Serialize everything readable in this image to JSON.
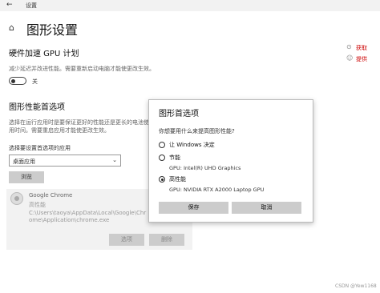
{
  "window": {
    "back_glyph": "←",
    "title": "设置"
  },
  "page": {
    "home_icon": "home-icon",
    "title": "图形设置"
  },
  "hw_accel": {
    "heading": "硬件加速 GPU 计划",
    "description": "减少延迟并改进性能。需要重新启动电脑才能使更改生效。",
    "toggle_state": "关"
  },
  "perf_pref": {
    "heading": "图形性能首选项",
    "description": "选择在运行应用时是要保证更好的性能还是更长的电池使用时间。需要重启应用才能使更改生效。",
    "select_label": "选择要设置首选项的应用",
    "app_type": "桌面应用",
    "browse_label": "浏览"
  },
  "app_entry": {
    "name": "Google Chrome",
    "preference": "高性能",
    "path": "C:\\Users\\taoya\\AppData\\Local\\Google\\Chrome\\Application\\chrome.exe",
    "options_label": "选项",
    "remove_label": "删除"
  },
  "right_links": {
    "link1": "获取",
    "link2": "提供"
  },
  "dialog": {
    "title": "图形首选项",
    "question": "你想要用什么来提高图形性能?",
    "options": [
      {
        "label": "让 Windows 决定",
        "sub": "",
        "selected": false
      },
      {
        "label": "节能",
        "sub": "GPU: Intel(R) UHD Graphics",
        "selected": false
      },
      {
        "label": "高性能",
        "sub": "GPU: NVIDIA RTX A2000 Laptop GPU",
        "selected": true
      }
    ],
    "save_label": "保存",
    "cancel_label": "取消"
  },
  "watermark": "CSDN @Yew1168"
}
